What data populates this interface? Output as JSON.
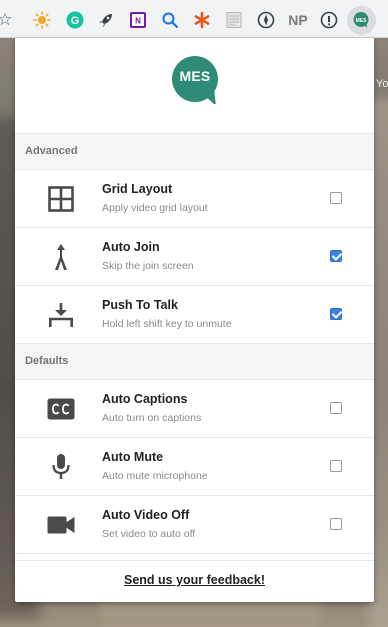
{
  "browser": {
    "extensions": [
      {
        "name": "bookmark-star-icon"
      },
      {
        "name": "sun-extension-icon"
      },
      {
        "name": "grammarly-icon"
      },
      {
        "name": "rocket-icon"
      },
      {
        "name": "onenote-icon"
      },
      {
        "name": "search-icon"
      },
      {
        "name": "asterisk-icon"
      },
      {
        "name": "document-icon"
      },
      {
        "name": "compass-icon"
      },
      {
        "name": "np-extension",
        "label": "NP"
      },
      {
        "name": "info-icon"
      },
      {
        "name": "mes-extension-icon"
      }
    ],
    "background_edge_text": "Yo"
  },
  "popup": {
    "logo_text": "MES",
    "logo_color": "#2f8c74",
    "sections": [
      {
        "label": "Advanced",
        "items": [
          {
            "title": "Grid Layout",
            "subtitle": "Apply video grid layout",
            "checked": false,
            "icon": "grid-icon"
          },
          {
            "title": "Auto Join",
            "subtitle": "Skip the join screen",
            "checked": true,
            "icon": "walk-icon"
          },
          {
            "title": "Push To Talk",
            "subtitle": "Hold left shift key to unmute",
            "checked": true,
            "icon": "push-down-icon"
          }
        ]
      },
      {
        "label": "Defaults",
        "items": [
          {
            "title": "Auto Captions",
            "subtitle": "Auto turn on captions",
            "checked": false,
            "icon": "closed-captions-icon"
          },
          {
            "title": "Auto Mute",
            "subtitle": "Auto mute microphone",
            "checked": false,
            "icon": "microphone-icon"
          },
          {
            "title": "Auto Video Off",
            "subtitle": "Set video to auto off",
            "checked": false,
            "icon": "video-camera-icon"
          }
        ]
      }
    ],
    "feedback_link": "Send us your feedback!",
    "accent_color": "#3b82e6"
  }
}
